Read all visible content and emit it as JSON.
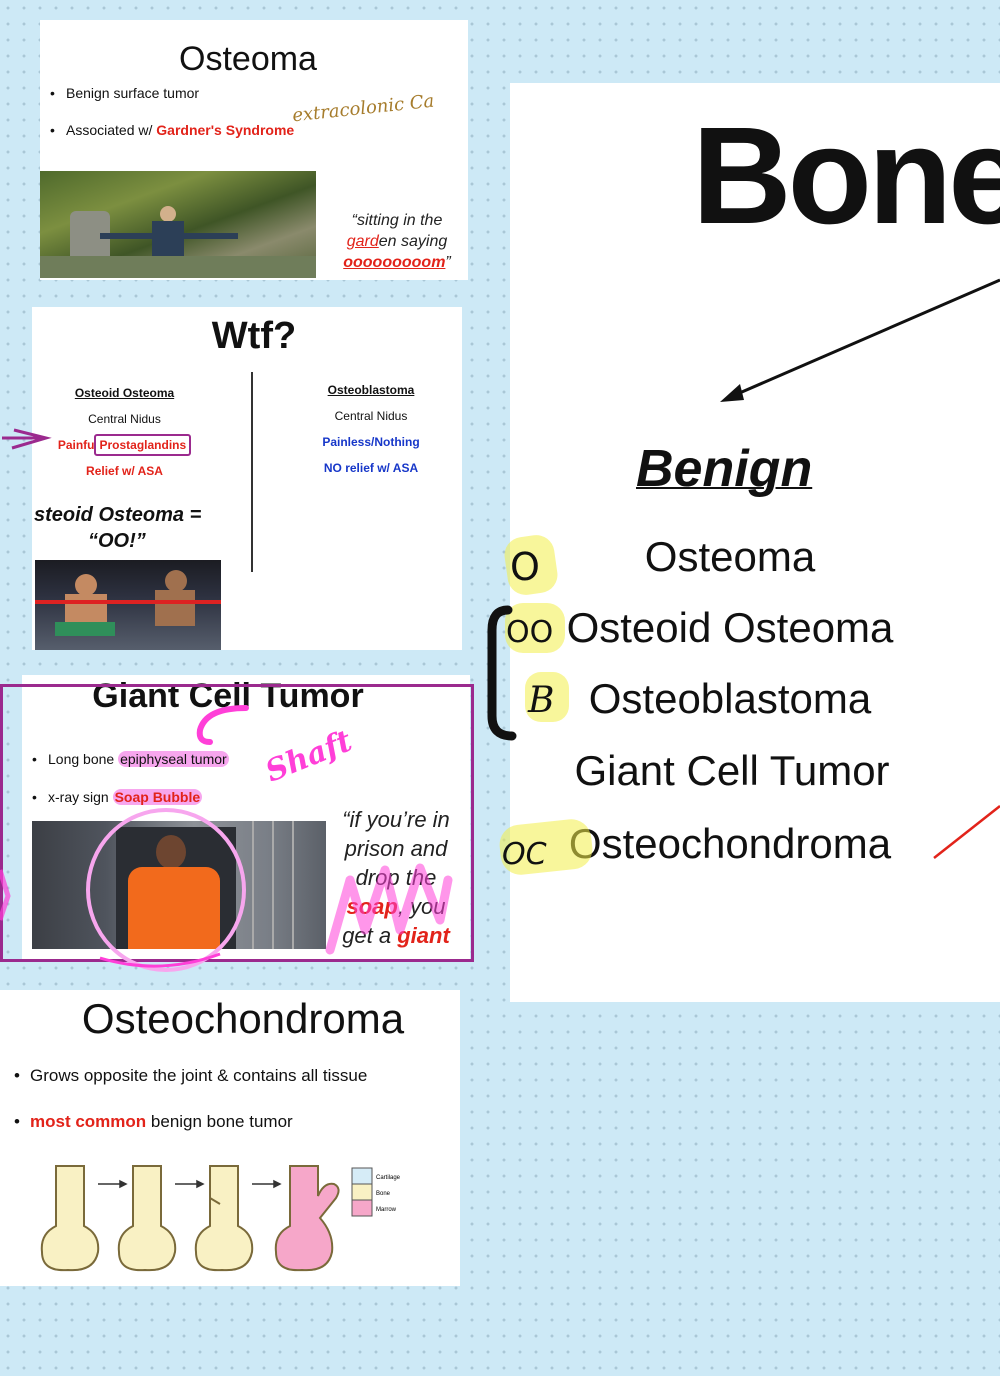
{
  "osteoma_slide": {
    "title": "Osteoma",
    "bullet1": "Benign surface tumor",
    "bullet2_prefix": "Associated w/ ",
    "bullet2_highlight": "Gardner's Syndrome",
    "annotation": "extracolonic Ca",
    "quote_line1": "“sitting in the",
    "quote_garden_red": "gard",
    "quote_garden_rest": "en saying",
    "quote_line3": "ooooooooom",
    "quote_end": "”"
  },
  "wtf_slide": {
    "title": "Wtf?",
    "left_header": "Osteoid Osteoma",
    "left_row1": "Central Nidus",
    "left_row2_a": "Painfu",
    "left_row2_b": "Prostaglandins",
    "left_row3": "Relief w/ ASA",
    "right_header": "Osteoblastoma",
    "right_row1": "Central Nidus",
    "right_row2": "Painless/Nothing",
    "right_row3": "NO relief w/ ASA",
    "mnemonic_line1": "steoid Osteoma =",
    "mnemonic_line2": "“OO!”"
  },
  "giant_cell_slide": {
    "title": "Giant Cell Tumor",
    "bullet1_prefix": "Long bone ",
    "bullet1_highlight": "epiphyseal tumor",
    "bullet2_prefix": "x-ray sign ",
    "bullet2_highlight": "Soap Bubble",
    "annotation": "Shaft",
    "quote_line1": "“if you’re in",
    "quote_line2": "prison and",
    "quote_line3": "drop the",
    "quote_soap": "soap",
    "quote_line4_rest": ", you",
    "quote_line5_prefix": "get a ",
    "quote_giant": "giant"
  },
  "osteochondroma_slide": {
    "title": "Osteochondroma",
    "bullet1": "Grows opposite the joint & contains all tissue",
    "bullet2_highlight": "most common",
    "bullet2_rest": " benign bone tumor",
    "legend": [
      "Cartilage",
      "Bone",
      "Marrow"
    ]
  },
  "bone_panel": {
    "title": "Bone",
    "category": "Benign",
    "items": [
      "Osteoma",
      "Osteoid Osteoma",
      "Osteoblastoma",
      "Giant Cell Tumor",
      "Osteochondroma"
    ],
    "handwritten_marks": [
      "O",
      "OO",
      "B",
      "OC"
    ]
  },
  "colors": {
    "background": "#cde9f6",
    "highlight_red": "#e2231a",
    "relief_blue": "#1737c9",
    "annotation_purple": "#9b2a8e",
    "annotation_magenta": "#ff3fd8",
    "annotation_yellow": "#f4ef4a",
    "annotation_gold": "#a67c2c"
  }
}
